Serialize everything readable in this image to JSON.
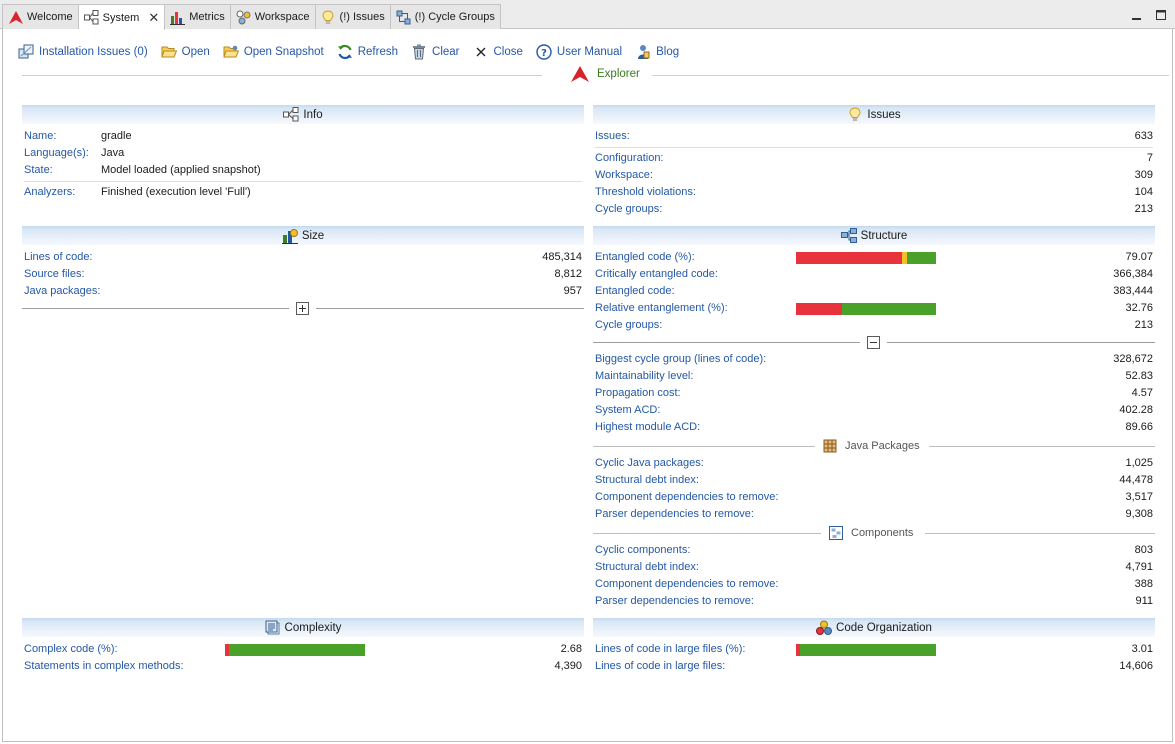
{
  "tabs": [
    {
      "label": "Welcome",
      "icon": "sonargraph-logo-icon",
      "active": false
    },
    {
      "label": "System",
      "icon": "system-tree-icon",
      "active": true,
      "close": "✕"
    },
    {
      "label": "Metrics",
      "icon": "metrics-icon",
      "active": false
    },
    {
      "label": "Workspace",
      "icon": "workspace-icon",
      "active": false
    },
    {
      "label": "(!) Issues",
      "icon": "lightbulb-icon",
      "active": false
    },
    {
      "label": "(!) Cycle Groups",
      "icon": "cycle-groups-icon",
      "active": false
    }
  ],
  "toolbar": {
    "installation_issues": "Installation Issues (0)",
    "open": "Open",
    "open_snapshot": "Open Snapshot",
    "refresh": "Refresh",
    "clear": "Clear",
    "close": "Close",
    "user_manual": "User Manual",
    "blog": "Blog"
  },
  "explorer_label": "Explorer",
  "info": {
    "title": "Info",
    "name_key": "Name:",
    "name_val": "gradle",
    "lang_key": "Language(s):",
    "lang_val": "Java",
    "state_key": "State:",
    "state_val": "Model loaded (applied snapshot)",
    "analyzers_key": "Analyzers:",
    "analyzers_val": "Finished (execution level 'Full')"
  },
  "issues": {
    "title": "Issues",
    "rows": [
      {
        "k": "Issues:",
        "v": "633"
      },
      {
        "k": "Configuration:",
        "v": "7"
      },
      {
        "k": "Workspace:",
        "v": "309"
      },
      {
        "k": "Threshold violations:",
        "v": "104"
      },
      {
        "k": "Cycle groups:",
        "v": "213"
      }
    ]
  },
  "size": {
    "title": "Size",
    "rows": [
      {
        "k": "Lines of code:",
        "v": "485,314"
      },
      {
        "k": "Source files:",
        "v": "8,812"
      },
      {
        "k": "Java packages:",
        "v": "957"
      }
    ]
  },
  "structure": {
    "title": "Structure",
    "rows": [
      {
        "k": "Entangled code (%):",
        "v": "79.07"
      },
      {
        "k": "Critically entangled code:",
        "v": "366,384"
      },
      {
        "k": "Entangled code:",
        "v": "383,444"
      },
      {
        "k": "Relative entanglement (%):",
        "v": "32.76"
      },
      {
        "k": "Cycle groups:",
        "v": "213"
      }
    ],
    "bars": {
      "entangled": {
        "red_pct": 75.5,
        "yellow_pct": 3.57,
        "green_pct": 20.93
      },
      "relative": {
        "red_pct": 32.76,
        "yellow_pct": 0,
        "green_pct": 67.24
      }
    },
    "more_rows": [
      {
        "k": "Biggest cycle group (lines of code):",
        "v": "328,672"
      },
      {
        "k": "Maintainability level:",
        "v": "52.83"
      },
      {
        "k": "Propagation cost:",
        "v": "4.57"
      },
      {
        "k": "System ACD:",
        "v": "402.28"
      },
      {
        "k": "Highest module ACD:",
        "v": "89.66"
      }
    ],
    "java_packages_label": "Java Packages",
    "java_rows": [
      {
        "k": "Cyclic Java packages:",
        "v": "1,025"
      },
      {
        "k": "Structural debt index:",
        "v": "44,478"
      },
      {
        "k": "Component dependencies to remove:",
        "v": "3,517"
      },
      {
        "k": "Parser dependencies to remove:",
        "v": "9,308"
      }
    ],
    "components_label": "Components",
    "comp_rows": [
      {
        "k": "Cyclic components:",
        "v": "803"
      },
      {
        "k": "Structural debt index:",
        "v": "4,791"
      },
      {
        "k": "Component dependencies to remove:",
        "v": "388"
      },
      {
        "k": "Parser dependencies to remove:",
        "v": "911"
      }
    ]
  },
  "complexity": {
    "title": "Complexity",
    "rows": [
      {
        "k": "Complex code (%):",
        "v": "2.68"
      },
      {
        "k": "Statements in complex methods:",
        "v": "4,390"
      }
    ],
    "bar": {
      "red_pct": 2.68,
      "green_pct": 97.32
    }
  },
  "code_org": {
    "title": "Code Organization",
    "rows": [
      {
        "k": "Lines of code in large files (%):",
        "v": "3.01"
      },
      {
        "k": "Lines of code in large files:",
        "v": "14,606"
      }
    ],
    "bar": {
      "red_pct": 3.01,
      "green_pct": 96.99
    }
  },
  "colors": {
    "link": "#2458a6",
    "accent_red": "#e8323c",
    "accent_green": "#4aa129",
    "accent_yellow": "#f2c029",
    "explorer_green": "#3a7a1e"
  }
}
